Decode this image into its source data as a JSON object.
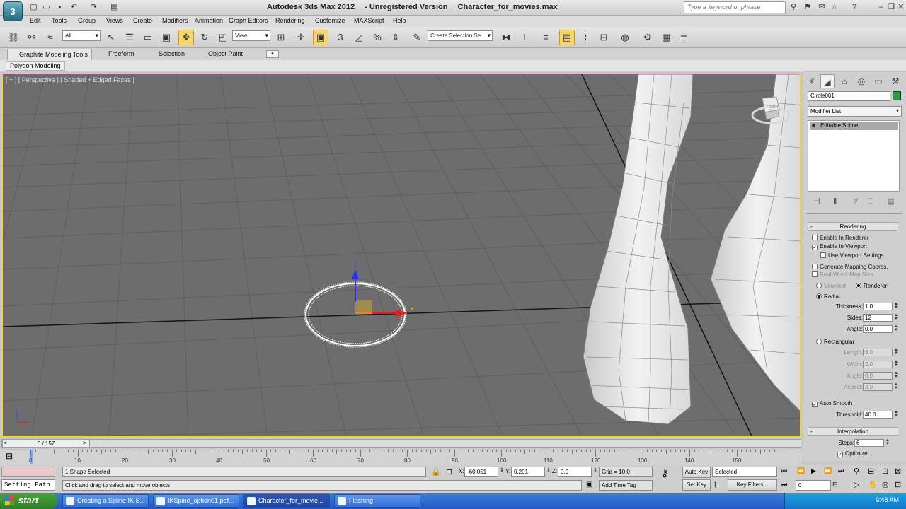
{
  "app": {
    "logo_text": "3",
    "title_parts": [
      "Autodesk 3ds Max  2012",
      "- Unregistered Version",
      "Character_for_movies.max"
    ],
    "search_placeholder": "Type a keyword or phrase"
  },
  "menu": [
    "Edit",
    "Tools",
    "Group",
    "Views",
    "Create",
    "Modifiers",
    "Animation",
    "Graph Editors",
    "Rendering",
    "Customize",
    "MAXScript",
    "Help"
  ],
  "toolbar": {
    "selection_filter": "All",
    "ref_coord": "View",
    "named_selection": "Create Selection Se"
  },
  "ribbon": {
    "tabs": [
      "Graphite Modeling Tools",
      "Freeform",
      "Selection",
      "Object Paint"
    ],
    "active_panel": "Polygon Modeling"
  },
  "viewport": {
    "label": "[ + ] [ Perspective ] [ Shaded + Edged Faces ]",
    "gizmo_x": "x",
    "gizmo_z": "z",
    "viewcube_label": "FRONT"
  },
  "command_panel": {
    "object_name": "Circle001",
    "object_color": "#1aa33a",
    "modifier_list": "Modifier List",
    "stack_items": [
      "Editable Spline"
    ],
    "rendering": {
      "title": "Rendering",
      "enable_in_renderer": "Enable In Renderer",
      "enable_in_viewport": "Enable In Viewport",
      "use_viewport_settings": "Use Viewport Settings",
      "generate_mapping": "Generate Mapping Coords.",
      "real_world": "Real-World Map Size",
      "viewport_opt": "Viewport",
      "renderer_opt": "Renderer",
      "radial": "Radial",
      "thickness_label": "Thickness:",
      "thickness": "1.0",
      "sides_label": "Sides:",
      "sides": "12",
      "angle_label": "Angle:",
      "angle": "0.0",
      "rectangular": "Rectangular",
      "length_label": "Length:",
      "length": "6.0",
      "width_label": "Width:",
      "width": "2.0",
      "rangle_label": "Angle:",
      "rangle": "0.0",
      "aspect_label": "Aspect:",
      "aspect": "3.0",
      "auto_smooth": "Auto Smooth",
      "threshold_label": "Threshold:",
      "threshold": "40.0"
    },
    "interpolation": {
      "title": "Interpolation",
      "steps_label": "Steps:",
      "steps": "6",
      "optimize": "Optimize"
    }
  },
  "timeline": {
    "frame": "0 / 157",
    "ticks": [
      "0",
      "10",
      "20",
      "30",
      "40",
      "50",
      "60",
      "70",
      "80",
      "90",
      "100",
      "110",
      "120",
      "130",
      "140",
      "150"
    ]
  },
  "status": {
    "selection": "1 Shape Selected",
    "prompt": "Click and drag to select and move objects",
    "x_label": "X:",
    "x": "-60.051",
    "y_label": "Y:",
    "y": "0.201",
    "z_label": "Z:",
    "z": "0.0",
    "grid": "Grid = 10.0",
    "add_time_tag": "Add Time Tag",
    "auto_key": "Auto Key",
    "set_key": "Set Key",
    "key_mode": "Selected",
    "key_filters": "Key Filters...",
    "current_frame": "0",
    "listener_mode": "Setting Path"
  },
  "taskbar": {
    "start": "start",
    "items": [
      "Creating a Spline IK S...",
      "IKSpine_option01.pdf...",
      "Character_for_movie...",
      "Flashing"
    ],
    "clock": "9:48 AM"
  }
}
